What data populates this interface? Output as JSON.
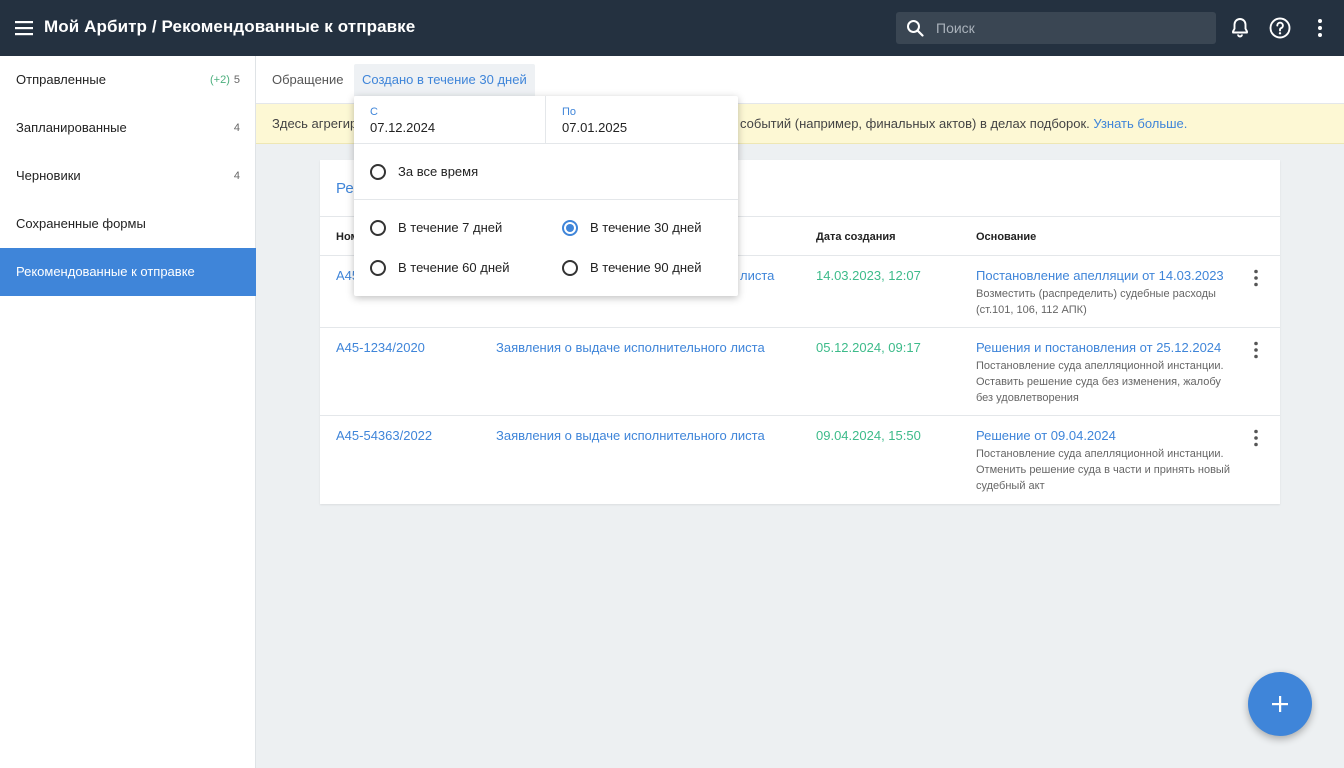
{
  "header": {
    "title": "Мой Арбитр / Рекомендованные к отправке",
    "search_placeholder": "Поиск",
    "icons": [
      "menu-icon",
      "search-icon",
      "bell-icon",
      "help-icon",
      "more-vertical-icon"
    ]
  },
  "sidebar": {
    "items": [
      {
        "label": "Отправленные",
        "badge": "(+2)",
        "count": "5"
      },
      {
        "label": "Запланированные",
        "count": "4"
      },
      {
        "label": "Черновики",
        "count": "4"
      },
      {
        "label": "Сохраненные формы"
      },
      {
        "label": "Рекомендованные к отправке",
        "active": true
      }
    ]
  },
  "tabs": {
    "items": [
      {
        "label": "Обращение"
      },
      {
        "label": "Создано в течение 30 дней",
        "active": true
      }
    ]
  },
  "notice": {
    "text_start": "Здесь агрегир",
    "text_end": "событий (например, финальных актов) в делах подборок.",
    "link": "Узнать больше."
  },
  "card": {
    "title": "Ре",
    "columns": [
      "Ном",
      "Дата создания",
      "Основание"
    ],
    "rows": [
      {
        "number": "А45",
        "type": "листа",
        "date": "14.03.2023, 12:07",
        "basis_link": "Постановление апелляции от 14.03.2023",
        "basis_desc": "Возместить (распределить) судебные расходы (ст.101, 106, 112 АПК)"
      },
      {
        "number": "А45-1234/2020",
        "type": "Заявления о выдаче исполнительного листа",
        "date": "05.12.2024, 09:17",
        "basis_link": "Решения и постановления от 25.12.2024",
        "basis_desc": "Постановление суда апелляционной инстанции. Оставить решение суда без изменения, жалобу без удовлетворения"
      },
      {
        "number": "А45-54363/2022",
        "type": "Заявления о выдаче исполнительного листа",
        "date": "09.04.2024, 15:50",
        "basis_link": "Решение от 09.04.2024",
        "basis_desc": "Постановление суда апелляционной инстанции. Отменить решение суда в части и принять новый судебный акт"
      }
    ]
  },
  "date_filter": {
    "from_label": "С",
    "from_value": "07.12.2024",
    "to_label": "По",
    "to_value": "07.01.2025",
    "options": [
      {
        "label": "За все время",
        "checked": false
      },
      {
        "label": "В течение 7 дней",
        "checked": false
      },
      {
        "label": "В течение 30 дней",
        "checked": true
      },
      {
        "label": "В течение 60 дней",
        "checked": false
      },
      {
        "label": "В течение 90 дней",
        "checked": false
      }
    ]
  },
  "colors": {
    "topbar": "#243140",
    "accent": "#3f85d9",
    "date_green": "#3dbb8a",
    "notice_bg": "#fdf8d4"
  }
}
